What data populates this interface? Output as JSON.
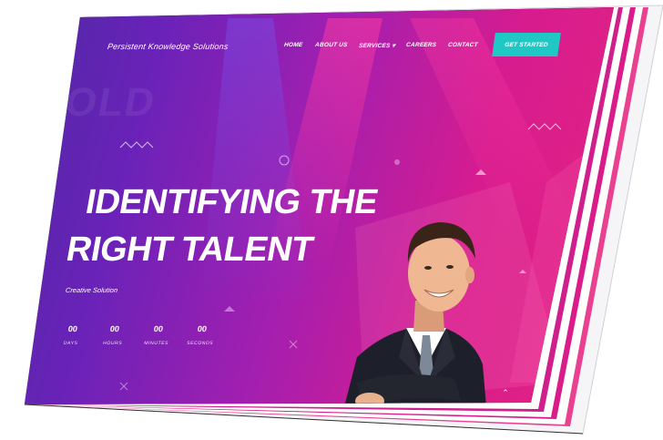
{
  "brand": "Persistent Knowledge Solutions",
  "nav": {
    "items": [
      {
        "label": "HOME"
      },
      {
        "label": "ABOUT US"
      },
      {
        "label": "SERVICES ▾"
      },
      {
        "label": "CAREERS"
      },
      {
        "label": "CONTACT"
      }
    ],
    "cta_label": "GET STARTED"
  },
  "hero": {
    "title_line1": "IDENTIFYING THE",
    "title_line2": "RIGHT TALENT",
    "subtitle": "Creative Solution",
    "watermark": "OLD"
  },
  "countdown": [
    {
      "value": "00",
      "label": "DAYS"
    },
    {
      "value": "00",
      "label": "HOURS"
    },
    {
      "value": "00",
      "label": "MINUTES"
    },
    {
      "value": "00",
      "label": "SECONDS"
    }
  ],
  "icons": {
    "scroll_top": "chevron-up-icon"
  },
  "colors": {
    "gradient_start": "#4a2aa3",
    "gradient_mid": "#a21fb0",
    "gradient_end": "#e8257d",
    "cta": "#1fc8c4",
    "text": "#ffffff"
  }
}
